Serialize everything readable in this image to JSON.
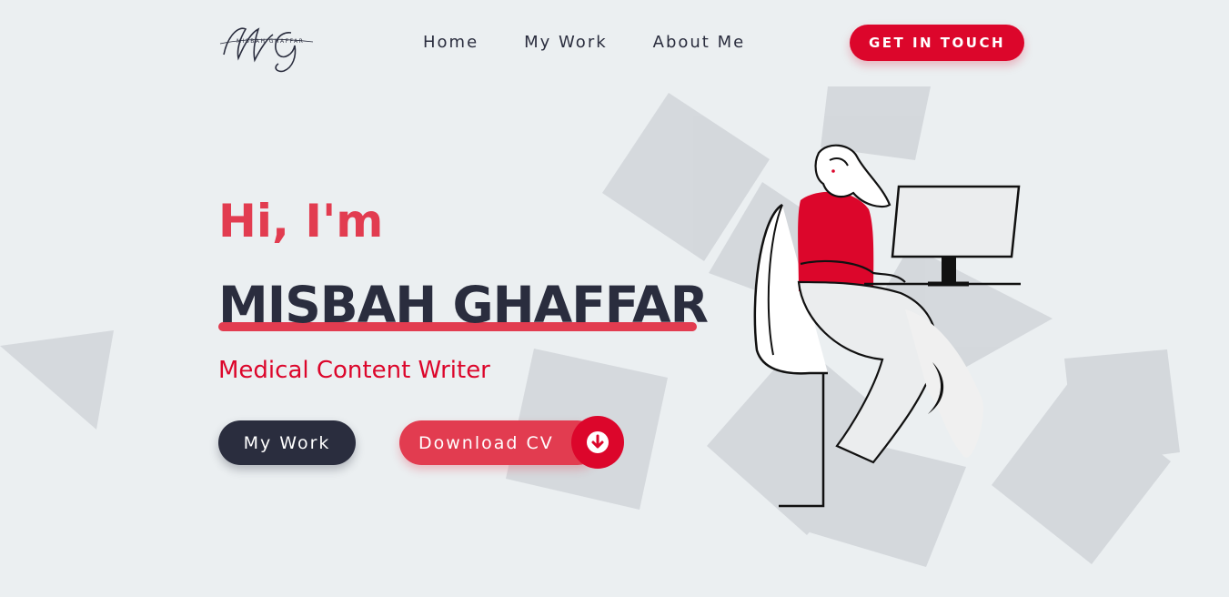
{
  "header": {
    "logo_alt": "MG monogram logo",
    "logo_lettering": "MISBAH GHAFFAR",
    "nav": [
      {
        "label": "Home"
      },
      {
        "label": "My Work"
      },
      {
        "label": "About Me"
      }
    ],
    "cta_label": "GET IN TOUCH"
  },
  "hero": {
    "greeting": "Hi, I'm",
    "name": "MISBAH GHAFFAR",
    "role": "Medical Content Writer",
    "buttons": {
      "work": "My Work",
      "cv": "Download CV"
    }
  },
  "colors": {
    "accent": "#dc062b",
    "accent_soft": "#e23c50",
    "dark": "#2a2d3e",
    "background": "#ebeff1",
    "shape": "#d3d6da"
  },
  "icons": {
    "cv_icon": "arrow-down-circle-icon",
    "illustration": "person-at-desk-illustration"
  }
}
